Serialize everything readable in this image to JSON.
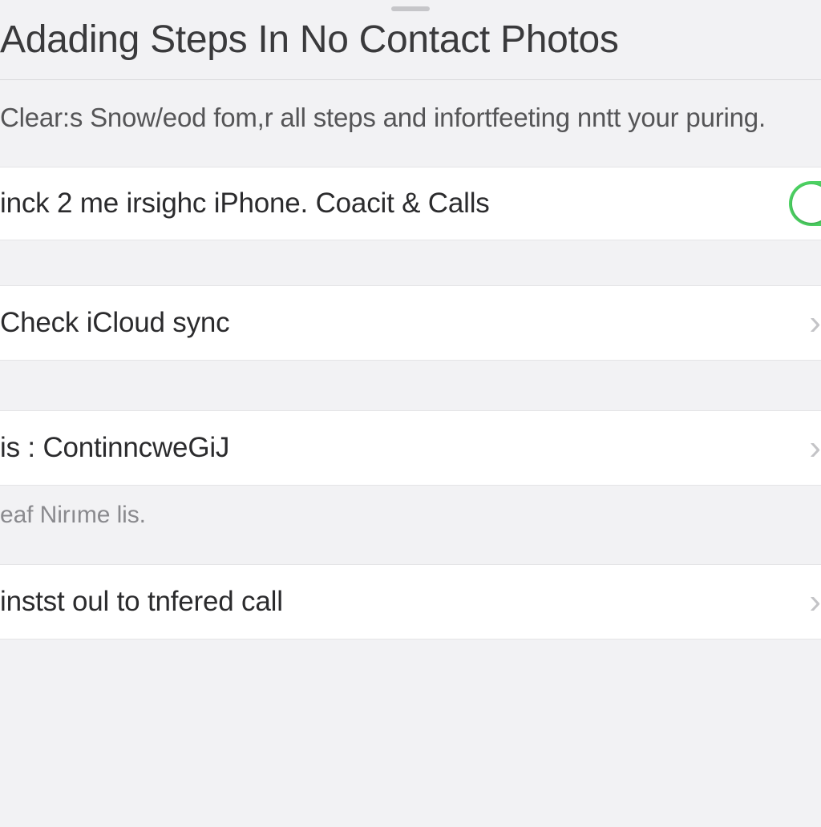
{
  "header": {
    "title": "Adading Steps In No Contact Photos"
  },
  "subtitle": "Clear:s Snow/eod fom,r all steps and infortfeeting nntt your puring.",
  "rows": {
    "r1": {
      "label": "inck 2 me irsighc iPhone. Coacit & Calls",
      "toggle_on": true
    },
    "r2": {
      "label": "Check iCloud sync"
    },
    "r3": {
      "label": "is : ContinncweGiJ"
    },
    "note": "eaf Nirıme lis.",
    "r4": {
      "label": "instst oul to tnfered call"
    }
  }
}
